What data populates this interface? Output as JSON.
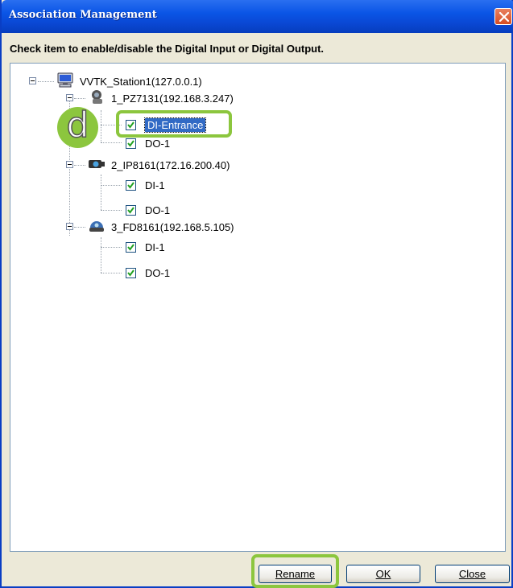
{
  "window": {
    "title": "Association Management",
    "instruction": "Check item to enable/disable the Digital Input or Digital Output."
  },
  "tree": {
    "root": {
      "label": "VVTK_Station1(127.0.0.1)",
      "icon": "computer-icon"
    },
    "devices": [
      {
        "label": "1_PZ7131(192.168.3.247)",
        "icon": "ptz-camera-icon",
        "items": [
          {
            "label": "DI-Entrance",
            "checked": true,
            "selected": true
          },
          {
            "label": "DO-1",
            "checked": true,
            "selected": false
          }
        ]
      },
      {
        "label": "2_IP8161(172.16.200.40)",
        "icon": "box-camera-icon",
        "items": [
          {
            "label": "DI-1",
            "checked": true,
            "selected": false
          },
          {
            "label": "DO-1",
            "checked": true,
            "selected": false
          }
        ]
      },
      {
        "label": "3_FD8161(192.168.5.105)",
        "icon": "dome-camera-icon",
        "items": [
          {
            "label": "DI-1",
            "checked": true,
            "selected": false
          },
          {
            "label": "DO-1",
            "checked": true,
            "selected": false
          }
        ]
      }
    ]
  },
  "callout": {
    "letter": "d"
  },
  "buttons": {
    "rename": "Rename",
    "ok": "OK",
    "close": "Close"
  },
  "colors": {
    "titlebar": "#0a55e6",
    "highlight": "#8cc63e",
    "selection": "#316ac5"
  }
}
